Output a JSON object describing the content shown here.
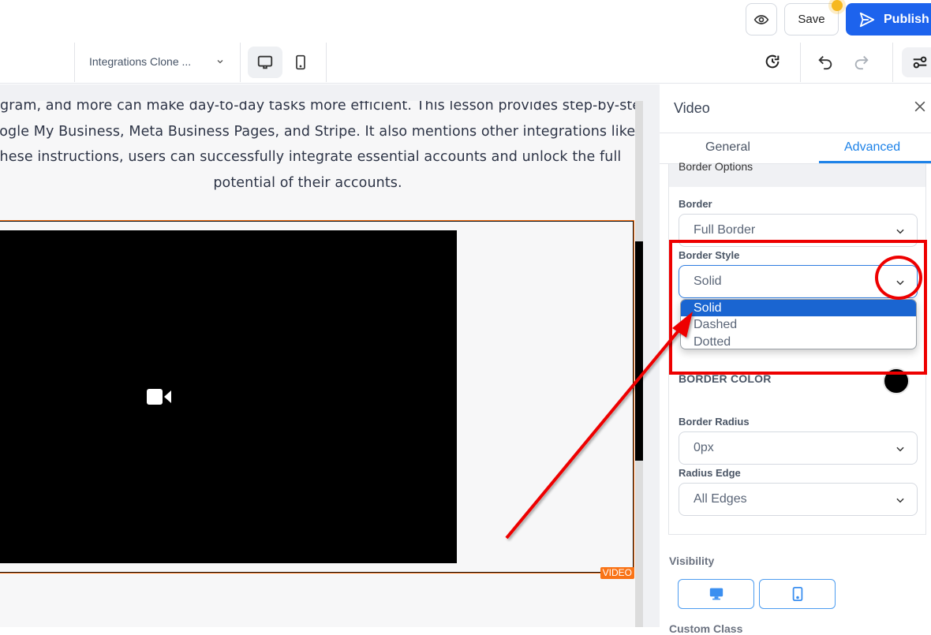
{
  "topbar": {
    "preview_icon": "eye-icon",
    "save_label": "Save",
    "publish_label": "Publish",
    "publish_icon": "send-icon",
    "notification_dot_color": "#f6b820"
  },
  "toolbar": {
    "page_selector": "Integrations Clone ...",
    "device_modes": [
      {
        "name": "desktop",
        "icon": "desktop-icon",
        "active": true
      },
      {
        "name": "mobile",
        "icon": "mobile-icon",
        "active": false
      }
    ],
    "history_icon": "history-icon",
    "undo_icon": "undo-icon",
    "redo_icon": "redo-icon",
    "settings_icon": "sliders-icon"
  },
  "canvas": {
    "paragraph_lines": [
      "Instagram, and more can make day-to-day tasks more efficient. This lesson provides step-by-step",
      "Google My Business, Meta Business Pages, and Stripe. It also mentions other integrations like",
      "these instructions, users can successfully integrate essential accounts and unlock the full",
      "potential of their accounts."
    ],
    "video_badge": "VIDEO",
    "video_icon": "video-camera-icon",
    "accent_color": "#f97316"
  },
  "panel": {
    "title": "Video",
    "close_icon": "close-icon",
    "tabs": [
      {
        "label": "General",
        "active": false
      },
      {
        "label": "Advanced",
        "active": true
      }
    ],
    "section_title": "Border Options",
    "fields": {
      "border": {
        "label": "Border",
        "value": "Full Border"
      },
      "border_style": {
        "label": "Border Style",
        "value": "Solid",
        "options": [
          "Solid",
          "Dashed",
          "Dotted"
        ],
        "highlighted": "Solid"
      },
      "border_color": {
        "label": "BORDER COLOR",
        "value": "#000000"
      },
      "border_radius": {
        "label": "Border Radius",
        "value": "0px"
      },
      "radius_edge": {
        "label": "Radius Edge",
        "value": "All Edges"
      }
    },
    "visibility": {
      "label": "Visibility",
      "buttons": [
        {
          "icon": "desktop-icon"
        },
        {
          "icon": "mobile-icon"
        }
      ]
    },
    "custom_class_label": "Custom Class"
  },
  "annotation": {
    "color": "#ee0000"
  }
}
